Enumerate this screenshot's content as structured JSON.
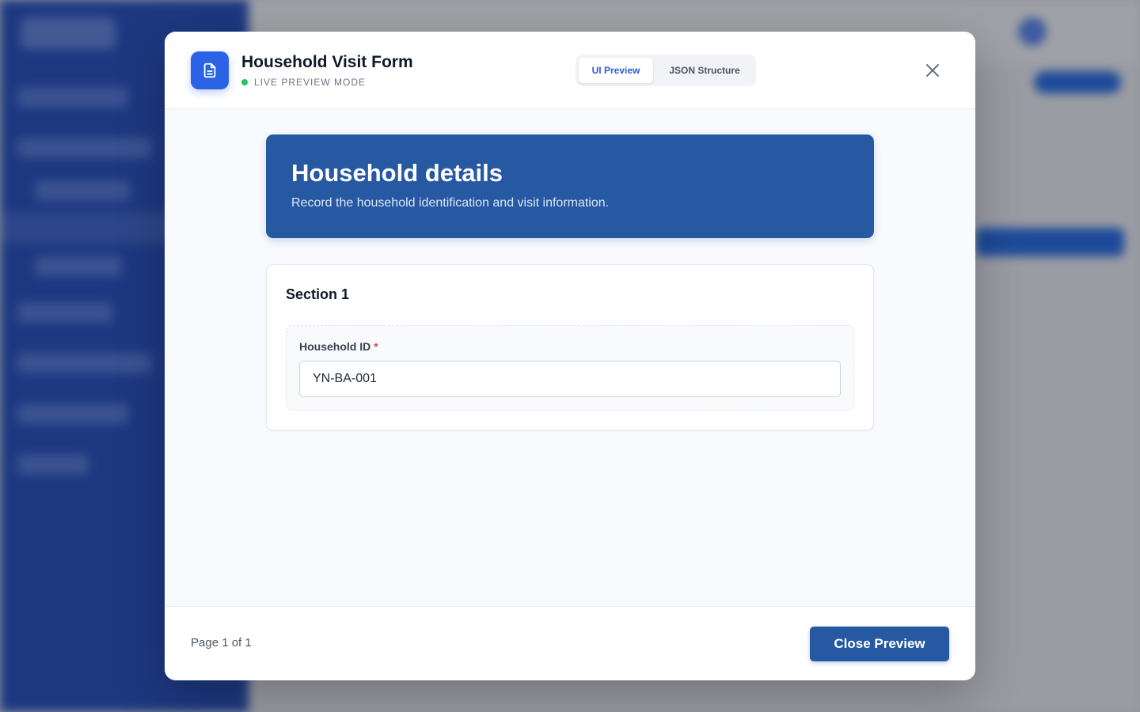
{
  "modal": {
    "title": "Household Visit Form",
    "mode_label": "LIVE PREVIEW MODE",
    "tabs": [
      {
        "label": "UI Preview",
        "active": true
      },
      {
        "label": "JSON Structure",
        "active": false
      }
    ],
    "icons": {
      "form": "document-icon",
      "close": "close-icon",
      "status": "status-dot-icon"
    }
  },
  "form": {
    "header": {
      "title": "Household details",
      "subtitle": "Record the household identification and visit information."
    },
    "sections": [
      {
        "title": "Section 1",
        "fields": [
          {
            "label": "Household ID",
            "required_mark": "*",
            "value": "YN-BA-001"
          }
        ]
      }
    ]
  },
  "footer": {
    "page_info": "Page 1 of 1",
    "close_button": "Close Preview"
  },
  "colors": {
    "primary": "#2659a2",
    "accent": "#2b63e6",
    "live_indicator": "#22c55e",
    "required": "#ef4444"
  }
}
